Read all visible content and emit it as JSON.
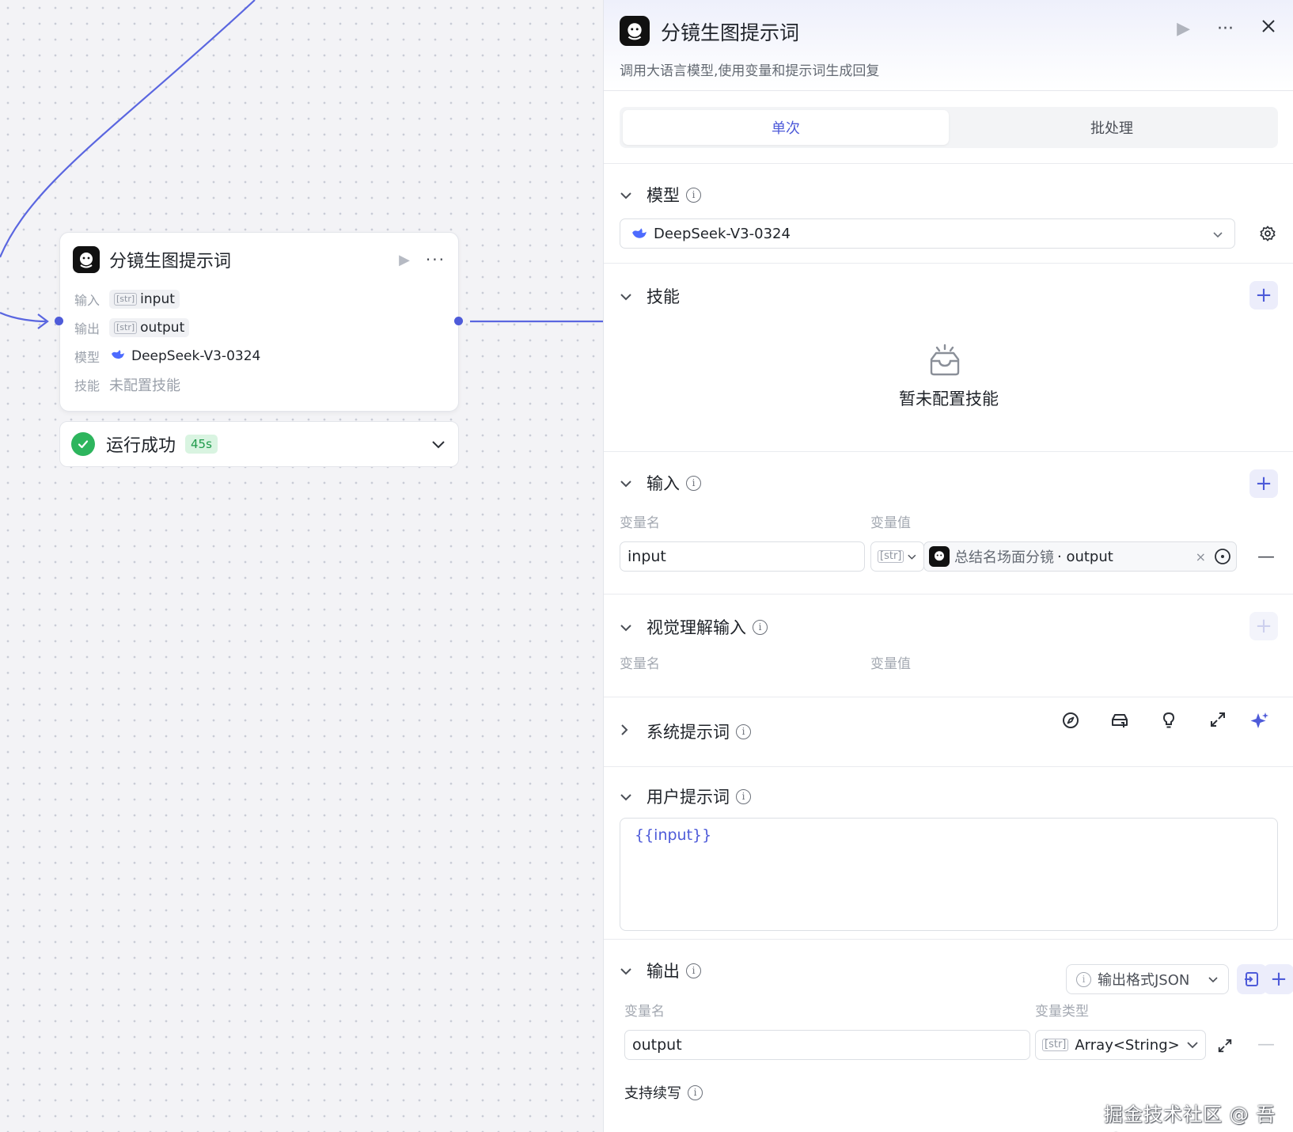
{
  "canvas": {
    "node": {
      "title": "分镜生图提示词",
      "rows": [
        {
          "label": "输入",
          "badge": "[str]",
          "value": "input"
        },
        {
          "label": "输出",
          "badge": "[str]",
          "value": "output"
        },
        {
          "label": "模型",
          "value": "DeepSeek-V3-0324"
        },
        {
          "label": "技能",
          "value": "未配置技能"
        }
      ]
    },
    "status": {
      "text": "运行成功",
      "duration": "45s"
    }
  },
  "panel": {
    "title": "分镜生图提示词",
    "subtitle": "调用大语言模型,使用变量和提示词生成回复",
    "tabs": [
      {
        "label": "单次",
        "active": true
      },
      {
        "label": "批处理",
        "active": false
      }
    ],
    "model": {
      "title": "模型",
      "selected": "DeepSeek-V3-0324"
    },
    "skills": {
      "title": "技能",
      "empty_text": "暂未配置技能"
    },
    "input": {
      "title": "输入",
      "col_name": "变量名",
      "col_value": "变量值",
      "rows": [
        {
          "name": "input",
          "type": "[str]",
          "ref": "总结名场面分镜",
          "ref_field": "· output"
        }
      ]
    },
    "vision_input": {
      "title": "视觉理解输入",
      "col_name": "变量名",
      "col_value": "变量值"
    },
    "system_prompt": {
      "title": "系统提示词"
    },
    "user_prompt": {
      "title": "用户提示词",
      "content": "{{input}}"
    },
    "output": {
      "title": "输出",
      "format_label": "输出格式JSON",
      "col_name": "变量名",
      "col_type": "变量类型",
      "rows": [
        {
          "name": "output",
          "type_badge": "[str]",
          "type": "Array<String>"
        }
      ],
      "stream_label": "支持续写"
    }
  },
  "watermark": "掘金技术社区 @ 吾鳴",
  "colors": {
    "accent": "#4e5bd9",
    "success": "#2db55d",
    "deepseek": "#4d6bfe"
  }
}
